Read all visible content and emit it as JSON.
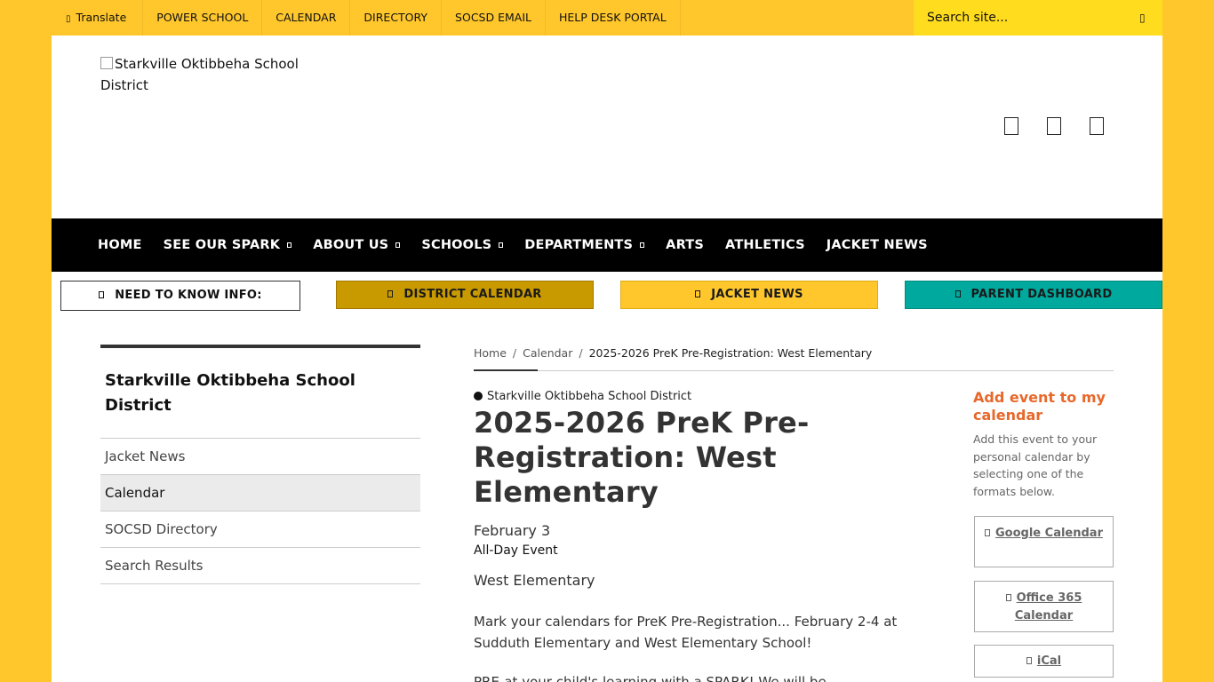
{
  "topbar": {
    "translate_label": "Translate",
    "links": [
      "POWER SCHOOL",
      "CALENDAR",
      "DIRECTORY",
      "SOCSD EMAIL",
      "HELP DESK PORTAL"
    ],
    "search_placeholder": "Search site..."
  },
  "header": {
    "logo_alt": "Starkville Oktibbeha School District"
  },
  "mainnav": {
    "items": [
      {
        "label": "HOME",
        "dropdown": false
      },
      {
        "label": "SEE OUR SPARK",
        "dropdown": true
      },
      {
        "label": "ABOUT US",
        "dropdown": true
      },
      {
        "label": "SCHOOLS",
        "dropdown": true
      },
      {
        "label": "DEPARTMENTS",
        "dropdown": true
      },
      {
        "label": "ARTS",
        "dropdown": false
      },
      {
        "label": "ATHLETICS",
        "dropdown": false
      },
      {
        "label": "JACKET NEWS",
        "dropdown": false
      }
    ]
  },
  "quicklinks": {
    "need_to_know": "NEED TO KNOW INFO:",
    "district_calendar": "DISTRICT CALENDAR",
    "jacket_news": "JACKET NEWS",
    "parent_dashboard": "PARENT DASHBOARD"
  },
  "sidebar": {
    "title": "Starkville Oktibbeha School District",
    "items": [
      {
        "label": "Jacket News",
        "active": false
      },
      {
        "label": "Calendar",
        "active": true
      },
      {
        "label": "SOCSD Directory",
        "active": false
      },
      {
        "label": "Search Results",
        "active": false
      }
    ]
  },
  "breadcrumb": {
    "home": "Home",
    "calendar": "Calendar",
    "current": "2025-2026 PreK Pre-Registration: West Elementary"
  },
  "event": {
    "organization": "Starkville Oktibbeha School District",
    "title": "2025-2026 PreK Pre-Registration: West Elementary",
    "date": "February 3",
    "time": "All-Day Event",
    "location": "West Elementary",
    "description": "Mark your calendars for PreK Pre-Registration... February 2-4 at Sudduth Elementary and West Elementary School!",
    "description_more": "PRE-at your child's learning with a SPARK! We will be..."
  },
  "addcal": {
    "heading": "Add event to my calendar",
    "text": "Add this event to your personal calendar by selecting one of the formats below.",
    "google": "Google Calendar",
    "office": "Office 365 Calendar",
    "ical": "iCal"
  },
  "colors": {
    "brand_yellow": "#ffc72c",
    "nav_black": "#000000",
    "gold_button": "#c99a00",
    "teal_button": "#00a99d",
    "accent_orange": "#e8672a"
  }
}
